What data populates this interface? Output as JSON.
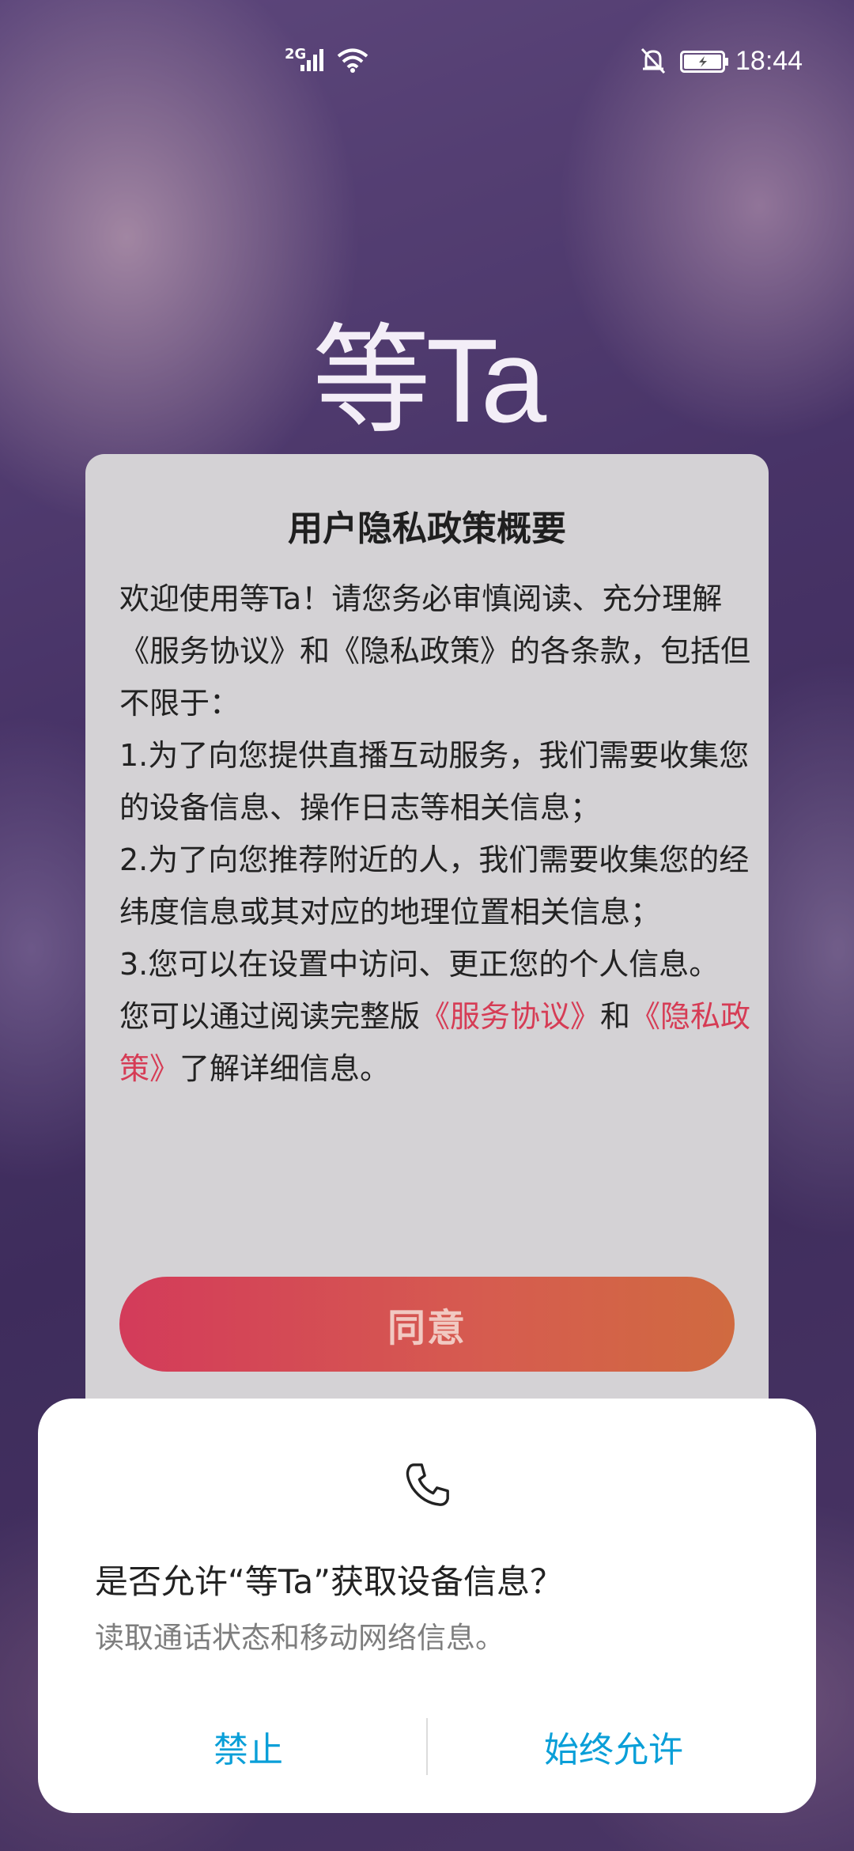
{
  "status_bar": {
    "network": "2G",
    "time": "18:44",
    "icons": [
      "signal-icon",
      "wifi-icon",
      "bell-off-icon",
      "battery-charging-icon"
    ]
  },
  "logo": {
    "text": "等Ta"
  },
  "privacy_card": {
    "title": "用户隐私政策概要",
    "intro": "欢迎使用等Ta！请您务必审慎阅读、充分理解《服务协议》和《隐私政策》的各条款，包括但不限于：",
    "items": [
      " 1.为了向您提供直播互动服务，我们需要收集您的设备信息、操作日志等相关信息；",
      " 2.为了向您推荐附近的人，我们需要收集您的经纬度信息或其对应的地理位置相关信息；",
      " 3.您可以在设置中访问、更正您的个人信息。"
    ],
    "footer_prefix": "您可以通过阅读完整版",
    "service_link": "《服务协议》",
    "footer_and": "和",
    "privacy_link": "《隐私政策》",
    "footer_suffix": "了解详细信息。",
    "agree_label": "同意"
  },
  "permission_dialog": {
    "icon": "phone-icon",
    "title": "是否允许“等Ta”获取设备信息？",
    "description": "读取通话状态和移动网络信息。",
    "deny_label": "禁止",
    "allow_label": "始终允许"
  },
  "colors": {
    "accent_link": "#d63c55",
    "dialog_button": "#0a9fd8",
    "agree_gradient_start": "#d33b5a",
    "agree_gradient_end": "#d06a40"
  }
}
